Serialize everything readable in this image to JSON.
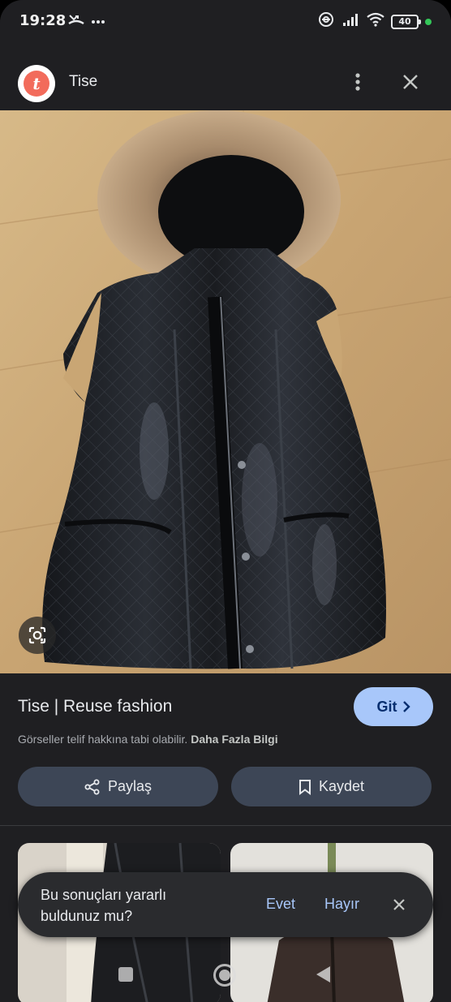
{
  "status_bar": {
    "time": "19:28",
    "battery_level": "40",
    "icons": [
      "missed-call-icon",
      "more-dots-icon",
      "link-icon",
      "signal-icon",
      "wifi-icon",
      "battery-icon",
      "privacy-dot"
    ]
  },
  "header": {
    "logo_letter": "t",
    "site_name": "Tise",
    "menu_icon": "more-vert-icon",
    "close_icon": "close-icon"
  },
  "image": {
    "description_icon": "google-lens-icon"
  },
  "result": {
    "title": "Tise | Reuse fashion",
    "visit_label": "Git",
    "copyright_text": "Görseller telif hakkına tabi olabilir.",
    "more_info_label": "Daha Fazla Bilgi"
  },
  "actions": {
    "share_label": "Paylaş",
    "save_label": "Kaydet"
  },
  "feedback": {
    "question": "Bu sonuçları yararlı buldunuz mu?",
    "yes_label": "Evet",
    "no_label": "Hayır"
  },
  "colors": {
    "background": "#1f1f22",
    "accent": "#a8c7fa",
    "button": "#3d4656",
    "logo": "#f26b5b"
  }
}
